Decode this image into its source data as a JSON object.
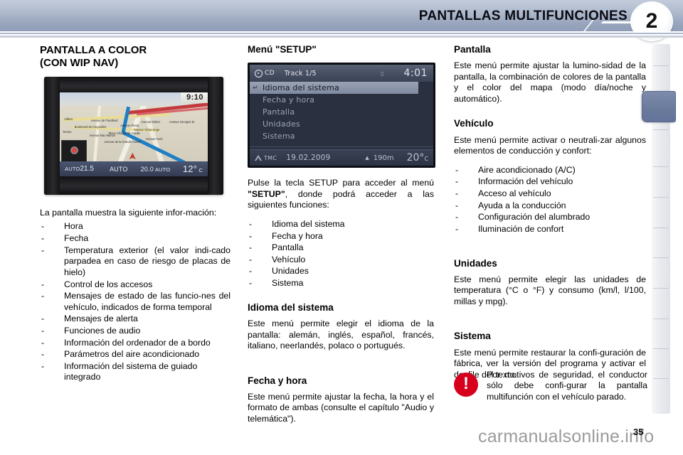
{
  "header": {
    "title": "PANTALLAS MULTIFUNCIONES",
    "chapter_number": "2"
  },
  "left_column": {
    "heading_line1": "PANTALLA A COLOR",
    "heading_line2": "(CON WIP NAV)",
    "nav_screen": {
      "clock": "9:10",
      "hvac_left_mode": "AUTO",
      "hvac_left_temp": "21.5",
      "hvac_center": "AUTO",
      "hvac_right_temp": "20.0",
      "hvac_right_mode": "AUTO",
      "outside_temp": "12°",
      "outside_temp_unit": "C",
      "map_labels": [
        "Villiers",
        "Avenue de Friedland",
        "Avenue Kleber",
        "Avenue Georges M",
        "Boulevard de Courcelles",
        "Avenue d'Iena",
        "Avenue Victor Hugo",
        "Place Charles de Gaulle",
        "Avenue Mac-Mahon",
        "Avenue Foch",
        "Avenue de la Grande Armee",
        "Ternes"
      ]
    },
    "lead": "La pantalla muestra la siguiente infor-­mación:",
    "items": [
      "Hora",
      "Fecha",
      "Temperatura exterior (el valor indi-cado parpadea en caso de riesgo de placas de hielo)",
      "Control de los accesos",
      "Mensajes de estado de las funcio-nes del vehículo, indicados de forma temporal",
      "Mensajes de alerta",
      "Funciones de audio",
      "Información del ordenador de a bordo",
      "Parámetros del aire acondicionado",
      "Información del sistema de guiado integrado"
    ]
  },
  "middle_column": {
    "heading": "Menú \"SETUP\"",
    "setup_screen": {
      "source": "CD",
      "track": "Track 1/5",
      "time": "4:01",
      "menu_items": [
        "Idioma del sistema",
        "Fecha y hora",
        "Pantalla",
        "Unidades",
        "Sistema"
      ],
      "selected_index": 0,
      "tmc_label": "TMC",
      "date": "19.02.2009",
      "altitude": "190m",
      "temp": "20°",
      "temp_unit": "C"
    },
    "intro_1": "Pulse la tecla SETUP para acceder al menú ",
    "intro_bold": "\"SETUP\"",
    "intro_2": ", donde podrá acceder a las siguientes funciones:",
    "function_items": [
      "Idioma del sistema",
      "Fecha y hora",
      "Pantalla",
      "Vehículo",
      "Unidades",
      "Sistema"
    ],
    "idioma_heading": "Idioma del sistema",
    "idioma_body": "Este menú permite elegir el idioma de la pantalla: alemán, inglés, español, francés, italiano, neerlandés, polaco o portugués.",
    "fecha_heading": "Fecha y hora",
    "fecha_body": "Este menú permite ajustar la fecha, la hora y el formato de ambas (consulte el capítulo \"Audio y telemática\")."
  },
  "right_column": {
    "pantalla_heading": "Pantalla",
    "pantalla_body": "Este menú permite ajustar la lumino-sidad de la pantalla, la combinación de colores de la pantalla y el color del mapa (modo día/noche y automático).",
    "vehiculo_heading": "Vehículo",
    "vehiculo_body": "Este menú permite activar o neutrali-zar algunos elementos de conducción y confort:",
    "vehiculo_items": [
      "Aire acondicionado (A/C)",
      "Información del vehículo",
      "Acceso al vehículo",
      "Ayuda a la conducción",
      "Configuración del alumbrado",
      "Iluminación de confort"
    ],
    "unidades_heading": "Unidades",
    "unidades_body": "Este menú permite elegir las unidades de temperatura (°C o °F) y consumo (km/l, l/100, millas y mpg).",
    "sistema_heading": "Sistema",
    "sistema_body": "Este menú permite restaurar la confi-guración de fábrica, ver la versión del programa y activar el desfile del texto."
  },
  "warning": {
    "text": "Por motivos de seguridad, el conductor sólo debe confi-gurar la pantalla multifunción con el vehículo parado.",
    "icon_color": "#d6001c"
  },
  "footer": {
    "watermark": "carmanualsonline.info",
    "page_number": "35"
  }
}
